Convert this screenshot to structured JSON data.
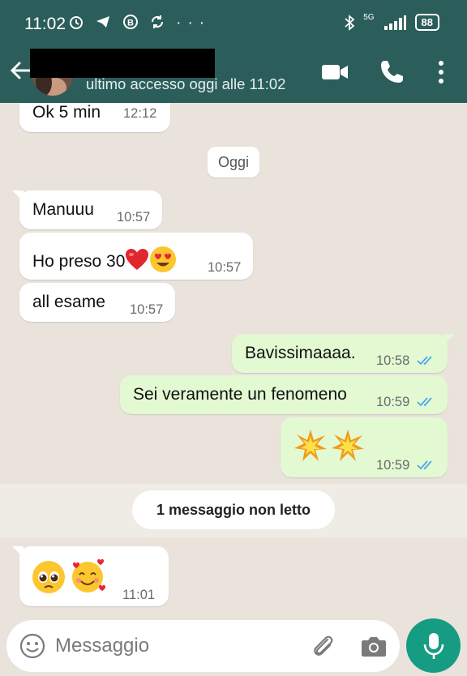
{
  "status_bar": {
    "time": "11:02",
    "left_icons": [
      "alarm-icon",
      "telegram-icon",
      "b-icon",
      "sync-icon",
      "more-dots-icon"
    ],
    "more": "···",
    "network": "5G",
    "battery": "88"
  },
  "header": {
    "contact_name": "",
    "last_seen": "ultimo accesso oggi alle 11:02",
    "icons": [
      "back-arrow-icon",
      "video-call-icon",
      "phone-icon",
      "kebab-menu-icon"
    ]
  },
  "chat": {
    "date_divider": "Oggi",
    "unread_divider": "1 messaggio non letto",
    "messages": [
      {
        "direction": "in",
        "text": "Ok 5 min",
        "time": "12:12"
      },
      {
        "direction": "in",
        "text": "Manuuu",
        "time": "10:57"
      },
      {
        "direction": "in",
        "text": "Ho preso 30",
        "emojis": [
          "red-heart",
          "heart-eyes-face"
        ],
        "time": "10:57"
      },
      {
        "direction": "in",
        "text": "all esame",
        "time": "10:57"
      },
      {
        "direction": "out",
        "text": "Bavissimaaaa.",
        "time": "10:58",
        "status": "read"
      },
      {
        "direction": "out",
        "text": "Sei veramente un fenomeno",
        "time": "10:59",
        "status": "read"
      },
      {
        "direction": "out",
        "text": "",
        "emojis": [
          "collision",
          "collision"
        ],
        "time": "10:59",
        "status": "read"
      },
      {
        "direction": "in",
        "text": "",
        "emojis": [
          "pleading-face",
          "smiling-face-with-hearts"
        ],
        "time": "11:01"
      }
    ]
  },
  "composer": {
    "placeholder": "Messaggio",
    "icons": [
      "emoji-icon",
      "attach-icon",
      "camera-icon",
      "mic-icon"
    ]
  },
  "colors": {
    "header_bg": "#2b5e5a",
    "chat_bg": "#e9e3dc",
    "outgoing_bubble": "#e2f9d2",
    "incoming_bubble": "#ffffff",
    "read_ticks": "#4fa6e8",
    "mic_button": "#169c82"
  }
}
